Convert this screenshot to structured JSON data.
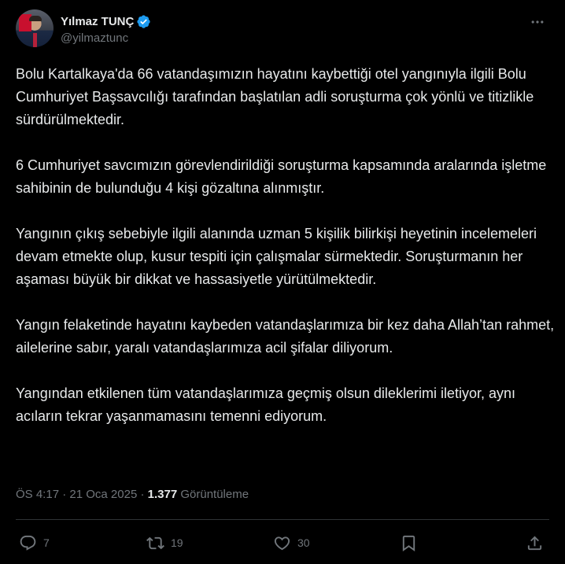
{
  "author": {
    "display_name": "Yılmaz TUNÇ",
    "handle": "@yilmaztunc",
    "verified": true,
    "verified_color": "#1d9bf0"
  },
  "tweet": {
    "paragraphs": [
      "Bolu Kartalkaya'da 66 vatandaşımızın hayatını kaybettiği otel yangınıyla ilgili Bolu Cumhuriyet Başsavcılığı tarafından başlatılan adli soruşturma çok yönlü ve titizlikle sürdürülmektedir.",
      "6 Cumhuriyet savcımızın görevlendirildiği soruşturma kapsamında aralarında işletme sahibinin de bulunduğu 4 kişi gözaltına alınmıştır.",
      "Yangının çıkış sebebiyle ilgili alanında uzman 5 kişilik bilirkişi heyetinin incelemeleri devam etmekte olup, kusur tespiti için çalışmalar sürmektedir. Soruşturmanın her aşaması büyük bir dikkat ve hassasiyetle yürütülmektedir.",
      "Yangın felaketinde hayatını kaybeden vatandaşlarımıza bir kez daha Allah’tan rahmet, ailelerine sabır, yaralı vatandaşlarımıza acil şifalar diliyorum.",
      "Yangından etkilenen tüm vatandaşlarımıza geçmiş olsun dileklerimi iletiyor, aynı acıların tekrar yaşanmamasını temenni ediyorum."
    ]
  },
  "meta": {
    "time": "ÖS 4:17",
    "separator": "·",
    "date": "21 Oca 2025",
    "views_count": "1.377",
    "views_label": "Görüntüleme"
  },
  "actions": {
    "replies": {
      "icon": "reply-icon",
      "count": "7"
    },
    "reposts": {
      "icon": "repost-icon",
      "count": "19"
    },
    "likes": {
      "icon": "like-icon",
      "count": "30"
    },
    "bookmark": {
      "icon": "bookmark-icon"
    },
    "share": {
      "icon": "share-icon"
    }
  },
  "colors": {
    "background": "#000000",
    "text_primary": "#e7e9ea",
    "text_secondary": "#71767b",
    "divider": "#2f3336"
  }
}
